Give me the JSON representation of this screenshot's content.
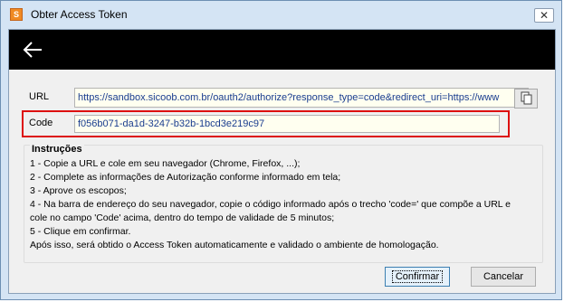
{
  "window": {
    "title": "Obter Access Token",
    "app_icon_glyph": "S",
    "close_glyph": "✕"
  },
  "header": {
    "back_icon": "arrow-left-icon"
  },
  "url_field": {
    "label": "URL",
    "value": "https://sandbox.sicoob.com.br/oauth2/authorize?response_type=code&redirect_uri=https://www"
  },
  "code_field": {
    "label": "Code",
    "value": "f056b071-da1d-3247-b32b-1bcd3e219c97"
  },
  "instructions": {
    "title": "Instruções",
    "lines": [
      "1 - Copie a URL e cole em seu navegador (Chrome, Firefox, ...);",
      "2 - Complete as informações de Autorização conforme informado em tela;",
      "3 - Aprove os escopos;",
      "4 - Na barra de endereço do seu navegador, copie o código informado após o trecho 'code=' que compõe a URL e",
      "cole no campo 'Code' acima, dentro do tempo de validade de 5 minutos;",
      "5 - Clique em confirmar.",
      "Após isso, será obtido o Access Token automaticamente e validado o ambiente de homologação."
    ]
  },
  "buttons": {
    "confirm": "Confirmar",
    "cancel": "Cancelar"
  },
  "colors": {
    "highlight": "#dd1010",
    "header": "#000000",
    "field_bg": "#fffff0"
  }
}
